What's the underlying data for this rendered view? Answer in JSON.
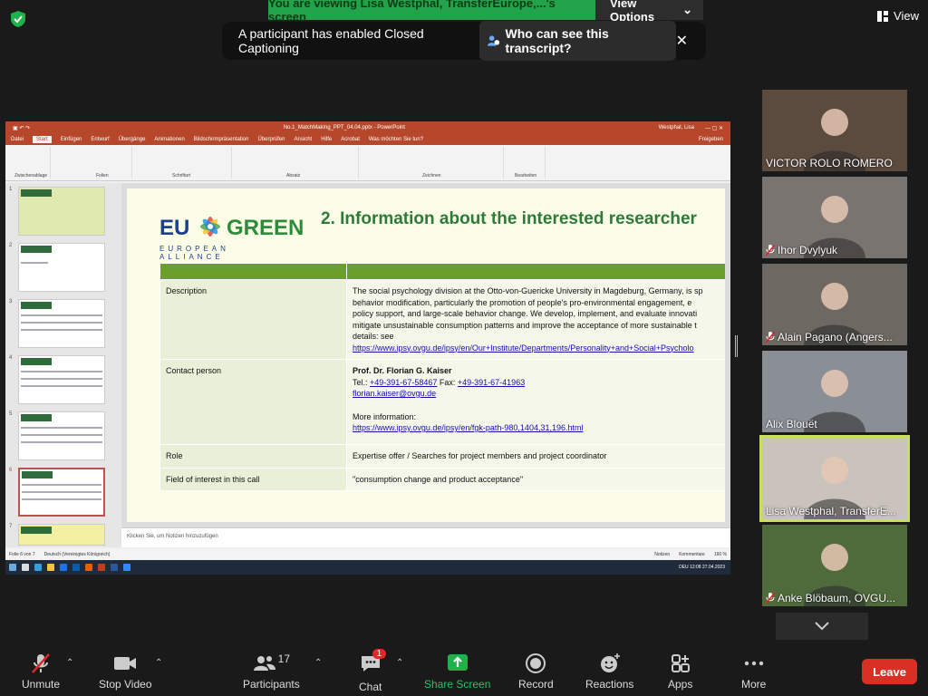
{
  "banner": {
    "viewing": "You are viewing Lisa Westphal, TransferEurope,...'s screen",
    "view_options": "View Options"
  },
  "top_right": {
    "view": "View"
  },
  "cc_notice": {
    "text": "A participant has enabled Closed Captioning",
    "who": "Who can see this transcript?"
  },
  "ppt": {
    "window_title": "No.1_MatchMaking_PPT_04.04.pptx - PowerPoint",
    "user": "Westphal, Lisa",
    "tabs": [
      "Datei",
      "Start",
      "Einfügen",
      "Entwurf",
      "Übergänge",
      "Animationen",
      "Bildschirmpräsentation",
      "Überprüfen",
      "Ansicht",
      "Hilfe",
      "Acrobat",
      "Was möchten Sie tun?"
    ],
    "share_btn": "Freigeben",
    "ribbon_groups": [
      "Zwischenablage",
      "Folien",
      "Schriftart",
      "Absatz",
      "Zeichnen",
      "Bearbeiten"
    ],
    "thumb_numbers": [
      "1",
      "2",
      "3",
      "4",
      "5",
      "6",
      "7"
    ],
    "slide": {
      "logo_eu": "EU",
      "logo_green": "GREEN",
      "logo_sub": "EUROPEAN ALLIANCE",
      "title": "2. Information about the interested researcher",
      "rows": [
        {
          "key": "Description",
          "lines": [
            "The social psychology division at the Otto-von-Guericke University in Magdeburg, Germany, is sp",
            "behavior modification, particularly the promotion of people's pro-environmental engagement, e",
            "policy support, and large-scale behavior change. We develop, implement, and evaluate innovati",
            "mitigate unsustainable consumption patterns and improve the acceptance of more sustainable t",
            "details: see"
          ],
          "link": "https://www.ipsy.ovgu.de/ipsy/en/Our+Institute/Departments/Personality+and+Social+Psycholo"
        },
        {
          "key": "Contact person",
          "name": "Prof. Dr. Florian G. Kaiser",
          "tel_label": "Tel.:",
          "tel": "+49-391-67-58467",
          "fax_label": "Fax:",
          "fax": "+49-391-67-41963",
          "email": "florian.kaiser@ovgu.de",
          "more": "More information:",
          "more_link": "https://www.ipsy.ovgu.de/ipsy/en/fgk-path-980,1404,31,196.html"
        },
        {
          "key": "Role",
          "value": "Expertise offer / Searches for project members and project coordinator"
        },
        {
          "key": "Field of interest in this call",
          "value": "\"consumption change and product acceptance\""
        }
      ]
    },
    "notes_placeholder": "Klicken Sie, um Notizen hinzuzufügen",
    "status": {
      "slide": "Folie 6 von 7",
      "lang": "Deutsch (Vereinigtes Königreich)",
      "notes": "Notizen",
      "comments": "Kommentare",
      "zoom": "160 %"
    },
    "clock": {
      "time": "12:08",
      "date": "27.04.2023",
      "lang": "DEU"
    }
  },
  "participants": [
    {
      "name": "VICTOR ROLO ROMERO",
      "muted": false,
      "bg": "#5b4a3e"
    },
    {
      "name": "Ihor Dvylyuk",
      "muted": true,
      "bg": "#7a7470"
    },
    {
      "name": "Alain Pagano (Angers...",
      "muted": true,
      "bg": "#6e6862"
    },
    {
      "name": "Alix Blouët",
      "muted": false,
      "bg": "#8a8f96"
    },
    {
      "name": "Lisa Westphal, TransferE...",
      "muted": false,
      "bg": "#c9c3bb"
    },
    {
      "name": "Anke Blöbaum, OVGU...",
      "muted": true,
      "bg": "#4f6b3c"
    }
  ],
  "toolbar": {
    "unmute": "Unmute",
    "stop_video": "Stop Video",
    "participants": "Participants",
    "participants_count": "17",
    "chat": "Chat",
    "chat_badge": "1",
    "share": "Share Screen",
    "record": "Record",
    "reactions": "Reactions",
    "apps": "Apps",
    "more": "More",
    "leave": "Leave"
  },
  "colors": {
    "zoom_green": "#22a249",
    "leave_red": "#d93025",
    "ppt_red": "#b7472a",
    "slide_title": "#2f7a3b",
    "active_speaker": "#c8e05a"
  }
}
